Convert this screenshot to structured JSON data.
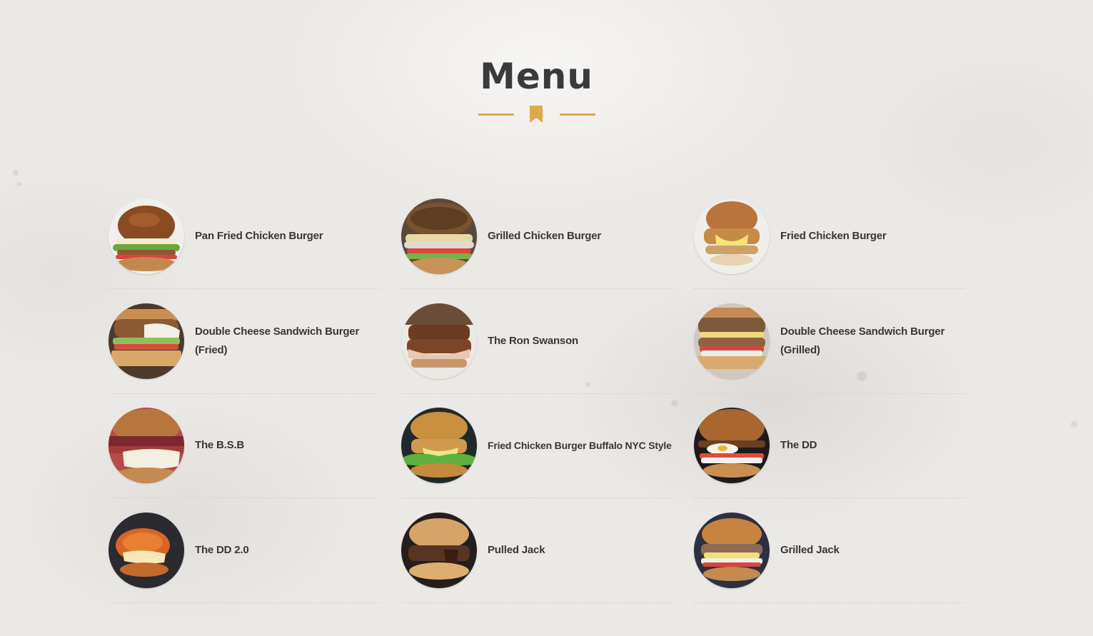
{
  "section": {
    "title": "Menu",
    "divider_icon": "bookmark-icon",
    "accent_color": "#e0a84a"
  },
  "menu_items": [
    {
      "name": "Pan Fried Chicken Burger",
      "icon": "burger-photo"
    },
    {
      "name": "Grilled Chicken Burger",
      "icon": "burger-photo"
    },
    {
      "name": "Fried Chicken Burger",
      "icon": "burger-photo"
    },
    {
      "name": "Double Cheese Sandwich Burger (Fried)",
      "icon": "burger-photo"
    },
    {
      "name": "The Ron Swanson",
      "icon": "burger-photo"
    },
    {
      "name": "Double Cheese Sandwich Burger (Grilled)",
      "icon": "burger-photo"
    },
    {
      "name": "The B.S.B",
      "icon": "burger-photo"
    },
    {
      "name": "Fried Chicken Burger Buffalo NYC Style",
      "icon": "burger-photo"
    },
    {
      "name": "The DD",
      "icon": "burger-photo"
    },
    {
      "name": "The DD 2.0",
      "icon": "burger-photo"
    },
    {
      "name": "Pulled Jack",
      "icon": "burger-photo"
    },
    {
      "name": "Grilled Jack",
      "icon": "burger-photo"
    }
  ]
}
